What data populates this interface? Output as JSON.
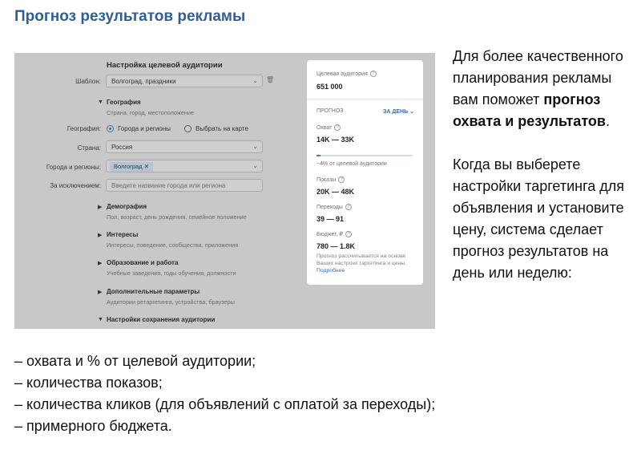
{
  "page_title": "Прогноз результатов рекламы",
  "screenshot": {
    "section_title": "Настройка целевой аудитории",
    "template_label": "Шаблон:",
    "template_value": "Волгоград, праздники",
    "geography": {
      "heading": "География",
      "subtitle": "Страна, город, местоположение",
      "geo_label": "География:",
      "option_regions": "Города и регионы",
      "option_map": "Выбрать на карте",
      "country_label": "Страна:",
      "country_value": "Россия",
      "cities_label": "Города и регионы:",
      "city_tag": "Волгоград",
      "exclude_label": "За исключением:",
      "exclude_placeholder": "Введите название города или региона"
    },
    "sections": [
      {
        "title": "Демография",
        "subtitle": "Пол, возраст, день рождения, семейное положение"
      },
      {
        "title": "Интересы",
        "subtitle": "Интересы, поведение, сообщества, приложения"
      },
      {
        "title": "Образование и работа",
        "subtitle": "Учебные заведения, годы обучения, должности"
      },
      {
        "title": "Дополнительные параметры",
        "subtitle": "Аудитории ретаргетинга, устройства, браузеры"
      },
      {
        "title": "Настройки сохранения аудитории",
        "subtitle": ""
      }
    ],
    "forecast": {
      "audience_label": "Целевая аудитория",
      "audience_value": "651 000",
      "forecast_label": "ПРОГНОЗ",
      "period": "ЗА ДЕНЬ",
      "reach_label": "Охват",
      "reach_value": "14K — 33K",
      "reach_share_percent": 4,
      "reach_note": "~4% от целевой аудитории",
      "impressions_label": "Показы",
      "impressions_value": "20K — 48K",
      "clicks_label": "Переходы",
      "clicks_value": "39 — 91",
      "budget_label": "Бюджет, ₽",
      "budget_value": "780 — 1.8K",
      "note": "Прогноз рассчитывается на основе Ваших настроек таргетинга и цены.",
      "more_link": "Подробнее"
    }
  },
  "side_text": {
    "p1_start": "Для более качественного планирования рекламы вам поможет ",
    "p1_bold": "прогноз охвата и результатов",
    "p1_end": ".",
    "p2": "Когда вы выберете настройки таргетинга для объявления и установите цену, система сделает прогноз результатов на день или неделю:"
  },
  "bullets": [
    "– охвата и % от целевой аудитории;",
    "– количества показов;",
    "– количества кликов (для объявлений с оплатой за переходы);",
    "– примерного бюджета."
  ]
}
